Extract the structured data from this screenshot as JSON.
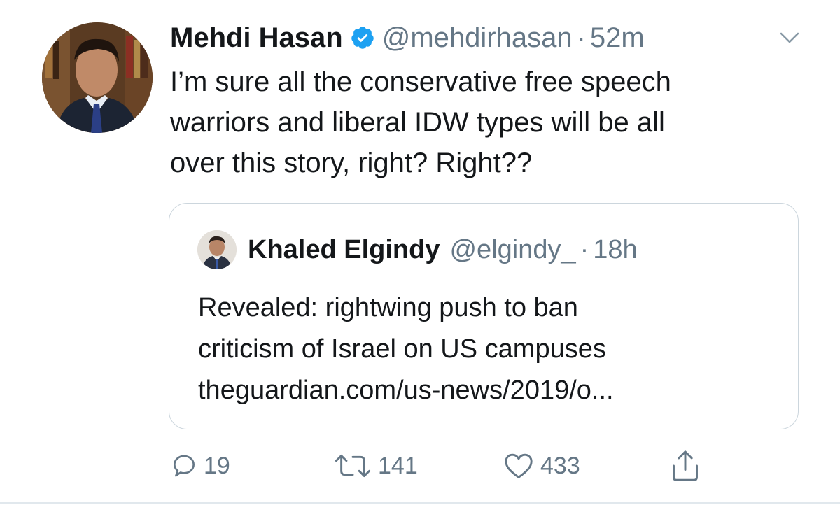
{
  "tweet": {
    "author_name": "Mehdi Hasan",
    "author_handle": "@mehdirhasan",
    "separator": "·",
    "time": "52m",
    "text_lines": [
      "I’m sure all the conservative free speech",
      "warriors and liberal IDW types will be all",
      "over this story, right? Right??"
    ]
  },
  "quoted_tweet": {
    "author_name": "Khaled Elgindy",
    "author_handle": "@elgindy_",
    "separator": "·",
    "time": "18h",
    "text_lines": [
      "Revealed: rightwing push to ban",
      "criticism of Israel on US campuses",
      "theguardian.com/us-news/2019/o..."
    ]
  },
  "actions": {
    "reply_count": "19",
    "retweet_count": "141",
    "like_count": "433"
  },
  "icons": {
    "verified": "verified-badge-icon",
    "more": "chevron-down-icon",
    "reply": "reply-icon",
    "retweet": "retweet-icon",
    "like": "heart-icon",
    "share": "share-icon"
  },
  "colors": {
    "verified_blue": "#1da1f2",
    "secondary_text": "#657786",
    "border": "#ccd6dd"
  }
}
